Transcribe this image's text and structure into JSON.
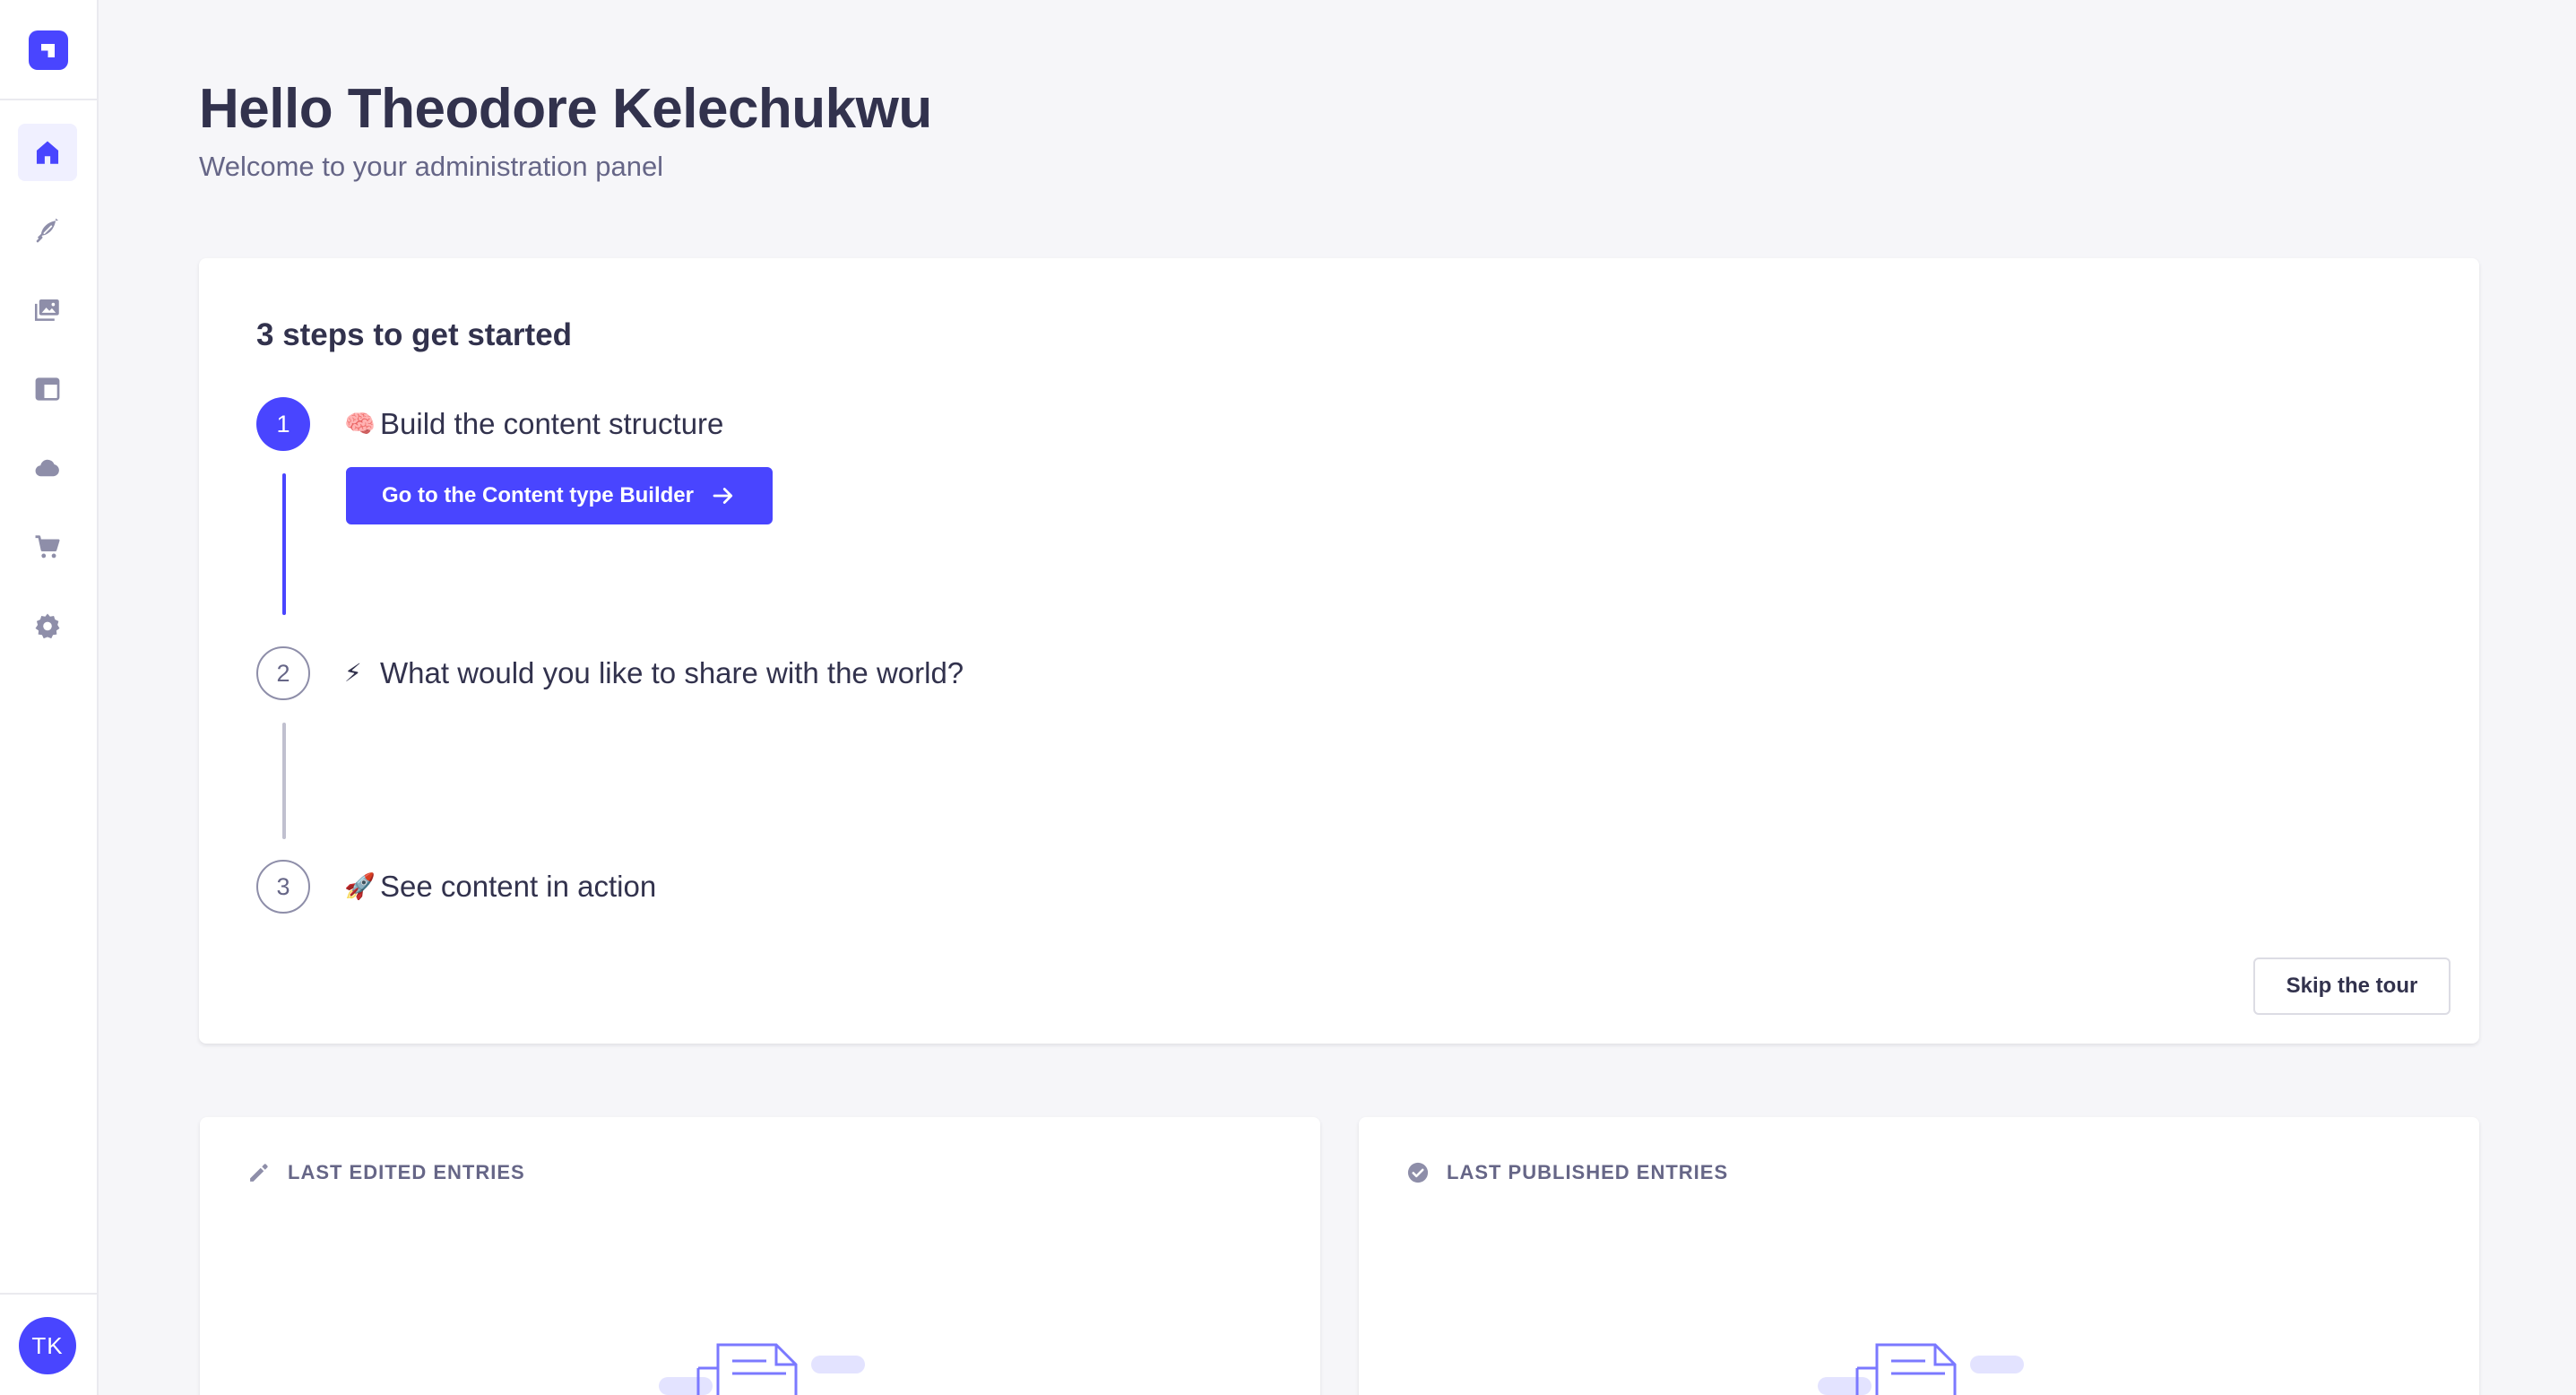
{
  "sidebar": {
    "brand_icon": "strapi-logo-icon",
    "items": [
      {
        "name": "home",
        "icon": "home-icon",
        "active": true
      },
      {
        "name": "content-manager",
        "icon": "feather-icon",
        "active": false
      },
      {
        "name": "media-library",
        "icon": "images-icon",
        "active": false
      },
      {
        "name": "content-type-builder",
        "icon": "layout-icon",
        "active": false
      },
      {
        "name": "cloud",
        "icon": "cloud-icon",
        "active": false
      },
      {
        "name": "marketplace",
        "icon": "cart-icon",
        "active": false
      },
      {
        "name": "settings",
        "icon": "gear-icon",
        "active": false
      }
    ],
    "user_initials": "TK"
  },
  "header": {
    "title": "Hello Theodore Kelechukwu",
    "subtitle": "Welcome to your administration panel"
  },
  "onboarding": {
    "title": "3 steps to get started",
    "steps": [
      {
        "number": "1",
        "emoji": "🧠",
        "label": "Build the content structure",
        "status": "active"
      },
      {
        "number": "2",
        "emoji": "⚡",
        "label": "What would you like to share with the world?",
        "status": "todo"
      },
      {
        "number": "3",
        "emoji": "🚀",
        "label": "See content in action",
        "status": "todo"
      }
    ],
    "cta_label": "Go to the Content type Builder",
    "skip_label": "Skip the tour"
  },
  "last_edited": {
    "title": "LAST EDITED ENTRIES",
    "icon": "pencil-icon"
  },
  "last_published": {
    "title": "LAST PUBLISHED ENTRIES",
    "icon": "check-circle-icon"
  },
  "colors": {
    "primary": "#4945ff",
    "background": "#f6f6f9",
    "text": "#32324d",
    "muted": "#666687",
    "icon": "#8e8ea9"
  }
}
